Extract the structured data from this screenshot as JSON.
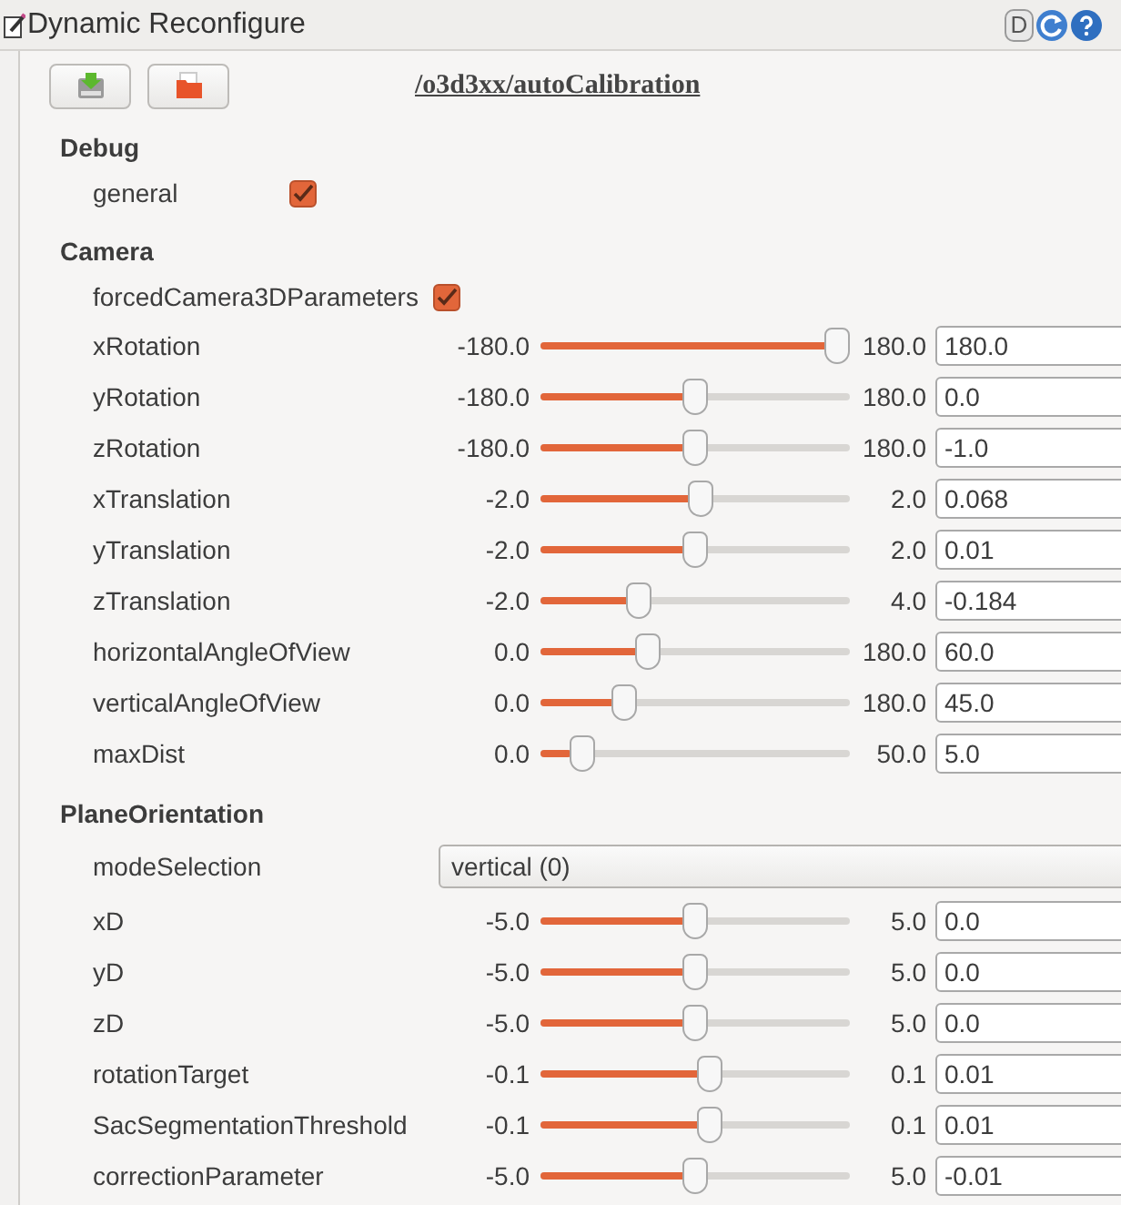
{
  "window": {
    "title": "Dynamic Reconfigure"
  },
  "node": "/o3d3xx/autoCalibration",
  "title_bar_buttons": [
    {
      "kind": "text",
      "label": "D"
    },
    {
      "kind": "refresh"
    },
    {
      "kind": "help"
    }
  ],
  "groups": [
    {
      "name": "Debug",
      "params": [
        {
          "kind": "checkbox",
          "label": "general",
          "checked": true
        }
      ]
    },
    {
      "name": "Camera",
      "params": [
        {
          "kind": "checkbox",
          "label": "forcedCamera3DParameters",
          "checked": true
        },
        {
          "kind": "slider",
          "label": "xRotation",
          "min": "-180.0",
          "max": "180.0",
          "level": 1,
          "value": "180.0"
        },
        {
          "kind": "slider",
          "label": "yRotation",
          "min": "-180.0",
          "max": "180.0",
          "level": 0.5,
          "value": "0.0"
        },
        {
          "kind": "slider",
          "label": "zRotation",
          "min": "-180.0",
          "max": "180.0",
          "level": 0.497,
          "value": "-1.0"
        },
        {
          "kind": "slider",
          "label": "xTranslation",
          "min": "-2.0",
          "max": "2.0",
          "level": 0.517,
          "value": "0.068"
        },
        {
          "kind": "slider",
          "label": "yTranslation",
          "min": "-2.0",
          "max": "2.0",
          "level": 0.503,
          "value": "0.01"
        },
        {
          "kind": "slider",
          "label": "zTranslation",
          "min": "-2.0",
          "max": "4.0",
          "level": 0.303,
          "value": "-0.184"
        },
        {
          "kind": "slider",
          "label": "horizontalAngleOfView",
          "min": "0.0",
          "max": "180.0",
          "level": 0.333,
          "value": "60.0"
        },
        {
          "kind": "slider",
          "label": "verticalAngleOfView",
          "min": "0.0",
          "max": "180.0",
          "level": 0.25,
          "value": "45.0"
        },
        {
          "kind": "slider",
          "label": "maxDist",
          "min": "0.0",
          "max": "50.0",
          "level": 0.1,
          "value": "5.0"
        }
      ]
    },
    {
      "name": "PlaneOrientation",
      "params": [
        {
          "kind": "dropdown",
          "label": "modeSelection",
          "value": "vertical (0)"
        },
        {
          "kind": "slider",
          "label": "xD",
          "min": "-5.0",
          "max": "5.0",
          "level": 0.5,
          "value": "0.0"
        },
        {
          "kind": "slider",
          "label": "yD",
          "min": "-5.0",
          "max": "5.0",
          "level": 0.5,
          "value": "0.0"
        },
        {
          "kind": "slider",
          "label": "zD",
          "min": "-5.0",
          "max": "5.0",
          "level": 0.5,
          "value": "0.0"
        },
        {
          "kind": "slider",
          "label": "rotationTarget",
          "min": "-0.1",
          "max": "0.1",
          "level": 0.55,
          "value": "0.01"
        },
        {
          "kind": "slider",
          "label": "SacSegmentationThreshold",
          "min": "-0.1",
          "max": "0.1",
          "level": 0.55,
          "value": "0.01"
        },
        {
          "kind": "slider",
          "label": "correctionParameter",
          "min": "-5.0",
          "max": "5.0",
          "level": 0.499,
          "value": "-0.01"
        }
      ]
    }
  ]
}
